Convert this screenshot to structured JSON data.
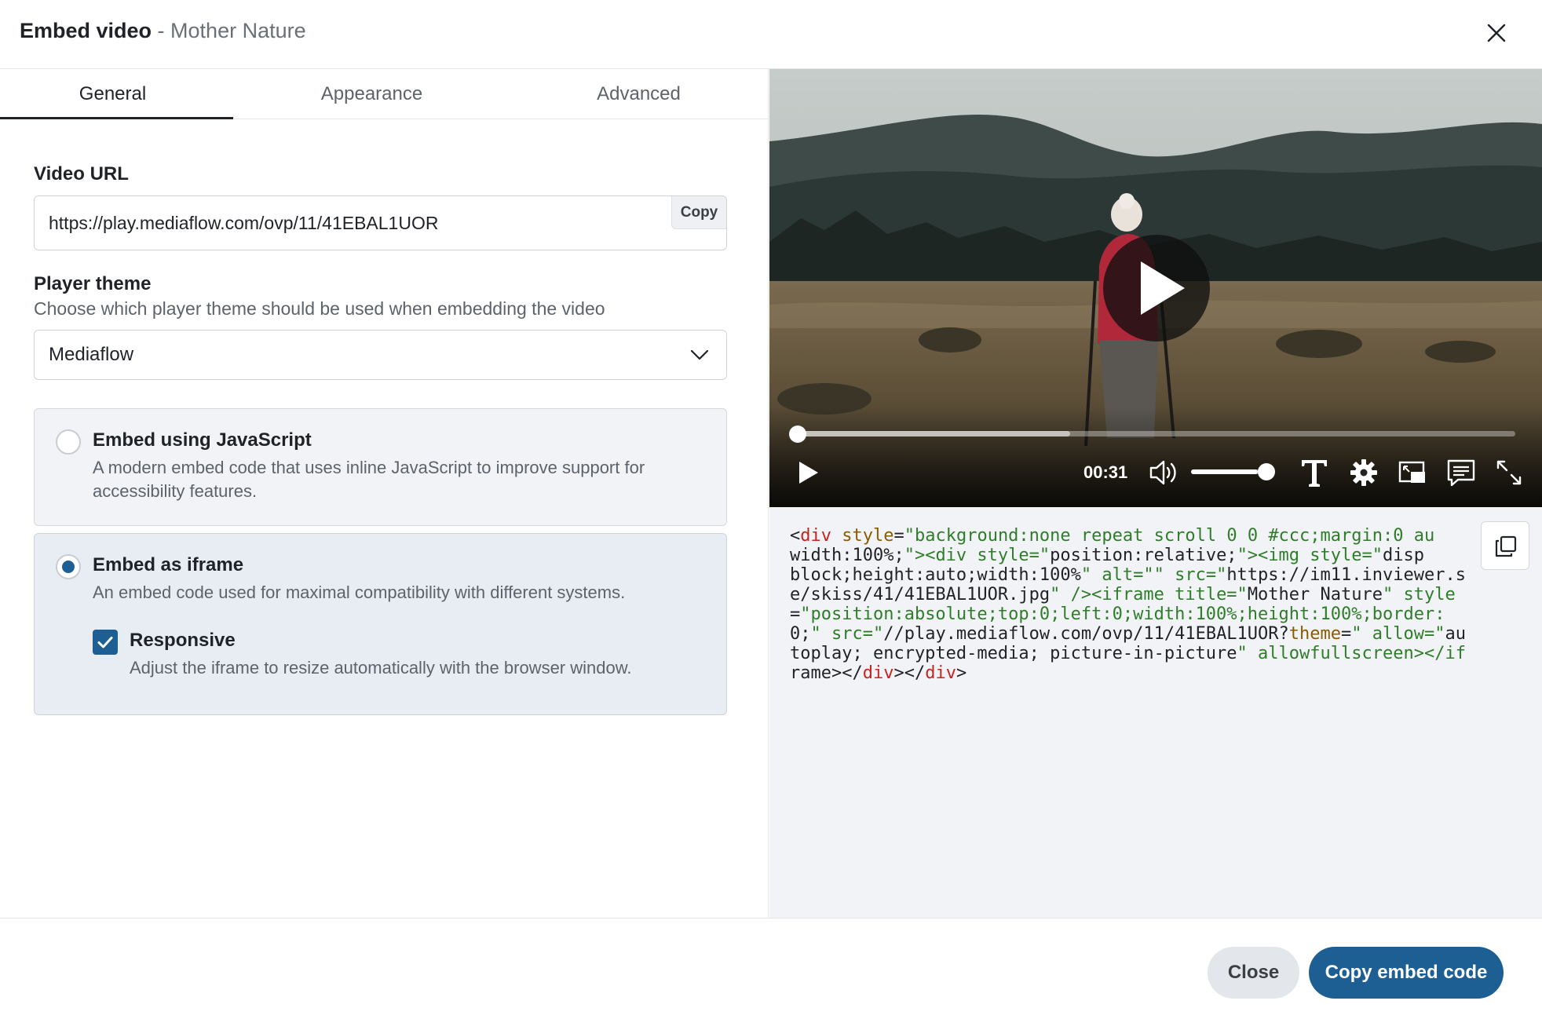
{
  "header": {
    "title": "Embed video",
    "separator": " - ",
    "video_name": "Mother Nature"
  },
  "tabs": [
    {
      "label": "General",
      "active": true
    },
    {
      "label": "Appearance",
      "active": false
    },
    {
      "label": "Advanced",
      "active": false
    }
  ],
  "general": {
    "video_url_label": "Video URL",
    "video_url_value": "https://play.mediaflow.com/ovp/11/41EBAL1UOR",
    "copy_label": "Copy",
    "player_theme_label": "Player theme",
    "player_theme_helper": "Choose which player theme should be used when embedding the video",
    "player_theme_value": "Mediaflow",
    "options": [
      {
        "title": "Embed using JavaScript",
        "description": "A modern embed code that uses inline JavaScript to improve support for accessibility features.",
        "selected": false
      },
      {
        "title": "Embed as iframe",
        "description": "An embed code used for maximal compatibility with different systems.",
        "selected": true
      }
    ],
    "responsive": {
      "label": "Responsive",
      "description": "Adjust the iframe to resize automatically with the browser window.",
      "checked": true
    }
  },
  "player": {
    "time": "00:31",
    "progress_fraction": 0.0,
    "buffered_fraction": 0.38,
    "volume_fraction": 0.8
  },
  "embed_code_lines": [
    "<div style=\"background:none repeat scroll 0 0 #ccc;margin:0 au",
    "width:100%;\"><div style=\"position:relative;\"><img style=\"disp",
    "block;height:auto;width:100%\" alt=\"\" src=\"https://im11.inviewer.s",
    "e/skiss/41/41EBAL1UOR.jpg\" /><iframe title=\"Mother Nature\" style",
    "=\"position:absolute;top:0;left:0;width:100%;height:100%;border:",
    "0;\" src=\"//play.mediaflow.com/ovp/11/41EBAL1UOR?theme=\" allow=\"au",
    "toplay; encrypted-media; picture-in-picture\" allowfullscreen></if",
    "rame></div></div>"
  ],
  "footer": {
    "close_label": "Close",
    "copy_embed_label": "Copy embed code"
  },
  "colors": {
    "accent": "#1d5e93",
    "tag": "#c8231f",
    "attr": "#8a5b00",
    "string": "#2f7d2a"
  }
}
